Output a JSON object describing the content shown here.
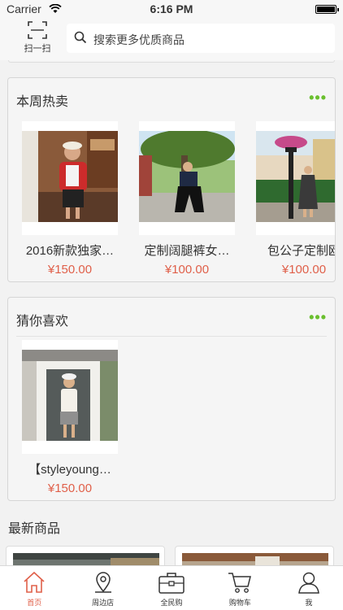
{
  "status_bar": {
    "carrier": "Carrier",
    "time": "6:16 PM"
  },
  "header": {
    "scan_label": "扫一扫",
    "search_placeholder": "搜索更多优质商品"
  },
  "hot_week": {
    "title": "本周热卖",
    "products": [
      {
        "name": "2016新款独家…",
        "price": "¥150.00"
      },
      {
        "name": "定制阔腿裤女…",
        "price": "¥100.00"
      },
      {
        "name": "包公子定制欧",
        "price": "¥100.00"
      }
    ]
  },
  "guess_like": {
    "title": "猜你喜欢",
    "products": [
      {
        "name": "【styleyoung…",
        "price": "¥150.00"
      }
    ]
  },
  "latest": {
    "title": "最新商品"
  },
  "tabs": [
    {
      "label": "首页",
      "icon": "home-icon",
      "active": true
    },
    {
      "label": "周边店",
      "icon": "location-icon",
      "active": false
    },
    {
      "label": "全民购",
      "icon": "briefcase-icon",
      "active": false
    },
    {
      "label": "购物车",
      "icon": "cart-icon",
      "active": false
    },
    {
      "label": "我",
      "icon": "person-icon",
      "active": false
    }
  ],
  "colors": {
    "accent": "#e0604a",
    "more": "#6abf2e",
    "background": "#f2f2f2"
  }
}
